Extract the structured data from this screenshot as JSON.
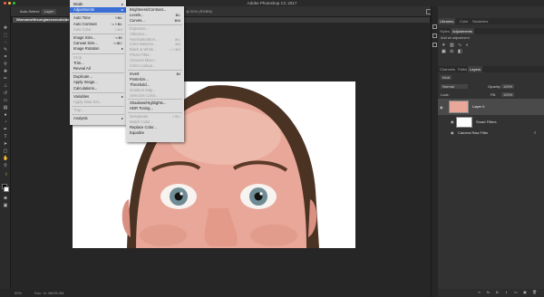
{
  "app": {
    "title": "Adobe Photoshop CC 2017"
  },
  "document": {
    "tab_label": "Womanwithsunglassesoutside",
    "zoom_info": "@ 50% (RGB/8)"
  },
  "optionsbar": {
    "auto_select_label": "Auto-Select:",
    "auto_select_value": "Layer"
  },
  "status": {
    "zoom": "50%",
    "doc_size": "Doc: 11.4M/36.2M"
  },
  "image_menu": {
    "items": [
      {
        "label": "Mode",
        "shortcut": "",
        "disabled": false,
        "submenu": true
      },
      {
        "label": "Adjustments",
        "shortcut": "",
        "disabled": false,
        "submenu": true,
        "selected": true
      },
      {
        "label": "Auto Tone",
        "shortcut": "⇧⌘L",
        "disabled": false
      },
      {
        "label": "Auto Contrast",
        "shortcut": "⌥⇧⌘L",
        "disabled": false
      },
      {
        "label": "Auto Color",
        "shortcut": "⇧⌘B",
        "disabled": true
      },
      {
        "label": "Image Size...",
        "shortcut": "⌥⌘I",
        "disabled": false
      },
      {
        "label": "Canvas Size...",
        "shortcut": "⌥⌘C",
        "disabled": false
      },
      {
        "label": "Image Rotation",
        "shortcut": "",
        "disabled": false,
        "submenu": true
      },
      {
        "label": "Crop",
        "shortcut": "",
        "disabled": true
      },
      {
        "label": "Trim...",
        "shortcut": "",
        "disabled": false
      },
      {
        "label": "Reveal All",
        "shortcut": "",
        "disabled": false
      },
      {
        "label": "Duplicate...",
        "shortcut": "",
        "disabled": false
      },
      {
        "label": "Apply Image...",
        "shortcut": "",
        "disabled": false
      },
      {
        "label": "Calculations...",
        "shortcut": "",
        "disabled": false
      },
      {
        "label": "Variables",
        "shortcut": "",
        "disabled": false,
        "submenu": true
      },
      {
        "label": "Apply Data Set...",
        "shortcut": "",
        "disabled": true
      },
      {
        "label": "Trap...",
        "shortcut": "",
        "disabled": true
      },
      {
        "label": "Analysis",
        "shortcut": "",
        "disabled": false,
        "submenu": true
      }
    ]
  },
  "adjust_menu": {
    "items": [
      {
        "label": "Brightness/Contrast...",
        "shortcut": "",
        "disabled": false
      },
      {
        "label": "Levels...",
        "shortcut": "⌘L",
        "disabled": false
      },
      {
        "label": "Curves...",
        "shortcut": "⌘M",
        "disabled": false
      },
      {
        "label": "Exposure...",
        "shortcut": "",
        "disabled": true
      },
      {
        "label": "Vibrance...",
        "shortcut": "",
        "disabled": true
      },
      {
        "label": "Hue/Saturation...",
        "shortcut": "⌘U",
        "disabled": true
      },
      {
        "label": "Color Balance...",
        "shortcut": "⌘B",
        "disabled": true
      },
      {
        "label": "Black & White...",
        "shortcut": "⌥⇧⌘B",
        "disabled": true
      },
      {
        "label": "Photo Filter...",
        "shortcut": "",
        "disabled": true
      },
      {
        "label": "Channel Mixer...",
        "shortcut": "",
        "disabled": true
      },
      {
        "label": "Color Lookup...",
        "shortcut": "",
        "disabled": true
      },
      {
        "label": "Invert",
        "shortcut": "⌘I",
        "disabled": false
      },
      {
        "label": "Posterize...",
        "shortcut": "",
        "disabled": false
      },
      {
        "label": "Threshold...",
        "shortcut": "",
        "disabled": false
      },
      {
        "label": "Gradient Map...",
        "shortcut": "",
        "disabled": true
      },
      {
        "label": "Selective Color...",
        "shortcut": "",
        "disabled": true
      },
      {
        "label": "Shadows/Highlights...",
        "shortcut": "",
        "disabled": false
      },
      {
        "label": "HDR Toning...",
        "shortcut": "",
        "disabled": false
      },
      {
        "label": "Desaturate",
        "shortcut": "⇧⌘U",
        "disabled": true
      },
      {
        "label": "Match Color...",
        "shortcut": "",
        "disabled": true
      },
      {
        "label": "Replace Color...",
        "shortcut": "",
        "disabled": false
      },
      {
        "label": "Equalize",
        "shortcut": "",
        "disabled": false
      }
    ]
  },
  "panels_top": {
    "tabs": [
      "Libraries",
      "Color",
      "Swatches"
    ],
    "subtabs": [
      "Styles",
      "Adjustments"
    ],
    "adjust_heading": "Add an adjustment"
  },
  "panels_layers": {
    "tabs": [
      "Channels",
      "Paths",
      "Layers"
    ],
    "kind_label": "Kind",
    "blend_mode": "Normal",
    "opacity_label": "Opacity:",
    "opacity_value": "100%",
    "lock_label": "Lock:",
    "fill_label": "Fill:",
    "fill_value": "100%",
    "layers": [
      {
        "name": "Layer 0",
        "selected": true
      },
      {
        "name": "Smart Filters",
        "selected": false
      },
      {
        "name": "Camera Raw Filter",
        "selected": false
      }
    ]
  },
  "colors": {
    "accent": "#3a6fd6",
    "menu_bg": "#dcdcdc",
    "panel_bg": "#323232"
  }
}
